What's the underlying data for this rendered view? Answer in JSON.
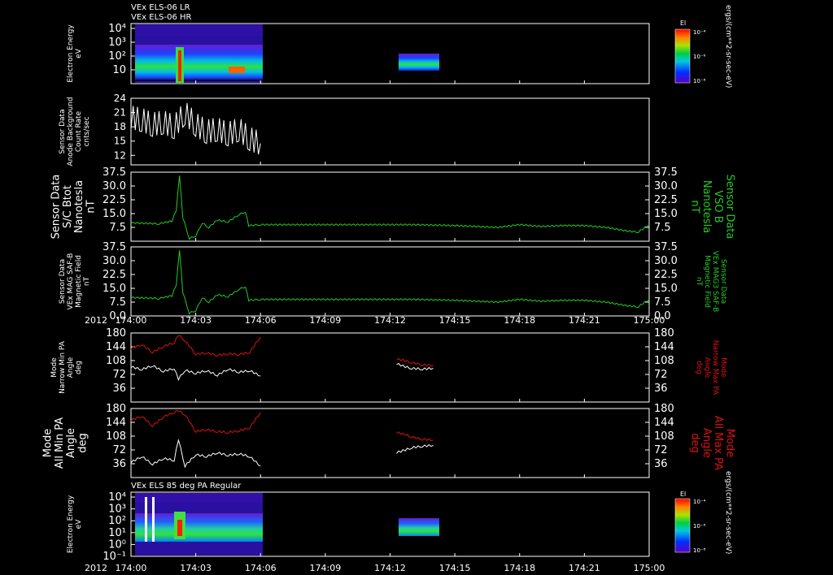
{
  "titles": {
    "top_line1": "VEx ELS-06 LR",
    "top_line2": "VEx ELS-06 HR",
    "bottom": "VEx ELS 85 deg PA Regular"
  },
  "colors": {
    "background": "#000000",
    "frame": "#ffffff",
    "white_trace": "#ffffff",
    "green_trace": "#22cc22",
    "red_trace": "#dd1111"
  },
  "colorbars": [
    {
      "label": "El",
      "ticks": [
        "10⁻⁴",
        "10⁻⁶",
        "10⁻⁸"
      ],
      "unit": "ergs/(cm**2-sr-sec-eV)"
    },
    {
      "label": "El",
      "ticks": [
        "10⁻⁴",
        "10⁻⁶",
        "10⁻⁸"
      ],
      "unit": "ergs/(cm**2-sr-sec-eV)"
    }
  ],
  "x_axis": {
    "year": "2012",
    "ticks": [
      "174:00",
      "174:03",
      "174:06",
      "174:09",
      "174:12",
      "174:15",
      "174:18",
      "174:21",
      "175:00"
    ]
  },
  "chart_data": [
    {
      "type": "heatmap",
      "ylabel": [
        "Electron Energy",
        "eV"
      ],
      "y_scale": "log",
      "y_ticks": [
        "10⁴",
        "10³",
        "10²",
        "10",
        ""
      ],
      "coverage_minutes": [
        [
          0,
          6
        ],
        [
          12.3,
          14
        ]
      ]
    },
    {
      "type": "line",
      "ylabel": [
        "Sensor Data",
        "Anode Background",
        "Count Rate",
        "cnts/sec"
      ],
      "y_ticks": [
        "24",
        "21",
        "18",
        "15",
        "12"
      ],
      "ylim": [
        10,
        24
      ],
      "series": [
        {
          "color": "#ffffff",
          "x": [
            0,
            0.5,
            1,
            1.5,
            2,
            2.5,
            3,
            3.5,
            4,
            4.5,
            5,
            5.5,
            6
          ],
          "values": [
            20,
            19.5,
            18.5,
            19,
            18,
            21,
            18.5,
            17,
            17.5,
            16.5,
            17.5,
            15.5,
            14.5
          ]
        }
      ]
    },
    {
      "type": "line",
      "ylabel": [
        "Sensor Data",
        "S/C Btot",
        "Nanotesla",
        "nT"
      ],
      "ylabel_right": [
        "Sensor Data",
        "VSO B",
        "Nanotesla",
        "nT"
      ],
      "y_ticks": [
        "37.5",
        "30.0",
        "22.5",
        "15.0",
        "7.5"
      ],
      "ylim": [
        0,
        37.5
      ],
      "series": [
        {
          "color": "#22cc22",
          "x": [
            0,
            1.3,
            1.9,
            2.1,
            2.25,
            2.4,
            2.7,
            3,
            3.3,
            3.6,
            4,
            4.5,
            5,
            5.3,
            5.45,
            6,
            9,
            13,
            15,
            16,
            17,
            18,
            19,
            20,
            21,
            22,
            23,
            23.5,
            24
          ],
          "values": [
            10,
            9.5,
            11,
            17,
            36,
            13,
            1.5,
            3,
            10,
            7.5,
            11.5,
            10.5,
            14.5,
            16,
            8.5,
            9,
            9,
            9,
            8.5,
            8,
            7.5,
            9,
            8,
            8.5,
            8.5,
            7.5,
            5.5,
            5,
            9
          ]
        }
      ]
    },
    {
      "type": "line",
      "ylabel": [
        "Sensor Data",
        "VEx MAG SAF-B",
        "Magnetic Field",
        "nT"
      ],
      "ylabel_right": [
        "Sensor Data",
        "VEx MAG3 SAF-B",
        "Magnetic Field",
        "nT"
      ],
      "y_ticks": [
        "37.5",
        "30.0",
        "22.5",
        "15.0",
        "7.5",
        "0.0"
      ],
      "ylim": [
        0,
        37.5
      ],
      "series": [
        {
          "color": "#22cc22",
          "x": [
            0,
            1.3,
            1.9,
            2.1,
            2.25,
            2.4,
            2.7,
            3,
            3.3,
            3.6,
            4,
            4.5,
            5,
            5.3,
            5.45,
            6,
            9,
            13,
            15,
            16,
            17,
            18,
            19,
            20,
            21,
            22,
            23,
            23.5,
            24
          ],
          "values": [
            10,
            9.5,
            11,
            17,
            36,
            13,
            1.5,
            3,
            10,
            7.5,
            11.5,
            10.5,
            14.5,
            16,
            8.5,
            9,
            9,
            9,
            8.5,
            8,
            7.5,
            9,
            8,
            8.5,
            8.5,
            7.5,
            5.5,
            5,
            9
          ]
        }
      ]
    },
    {
      "type": "line",
      "ylabel": [
        "Mode",
        "Narrow Min PA",
        "Angle",
        "deg"
      ],
      "ylabel_right": [
        "Mode",
        "Narrow Max PA",
        "Angle",
        "deg"
      ],
      "y_ticks": [
        "180",
        "144",
        "108",
        "72",
        "36"
      ],
      "ylim": [
        0,
        180
      ],
      "series": [
        {
          "color": "#dd1111",
          "segments": [
            {
              "x": [
                0,
                0.5,
                1,
                1.5,
                2,
                2.2,
                2.5,
                3,
                3.5,
                4,
                4.5,
                5,
                5.5,
                6
              ],
              "values": [
                140,
                150,
                130,
                145,
                155,
                175,
                160,
                125,
                128,
                122,
                126,
                124,
                130,
                170
              ]
            },
            {
              "x": [
                12.3,
                12.7,
                13,
                13.5,
                14
              ],
              "values": [
                112,
                108,
                103,
                97,
                96
              ]
            }
          ]
        },
        {
          "color": "#ffffff",
          "segments": [
            {
              "x": [
                0,
                0.5,
                1,
                1.5,
                2,
                2.2,
                2.5,
                3,
                3.5,
                4,
                4.5,
                5,
                5.5,
                6
              ],
              "values": [
                92,
                85,
                95,
                80,
                88,
                60,
                83,
                75,
                82,
                70,
                86,
                78,
                82,
                68
              ]
            },
            {
              "x": [
                12.3,
                12.7,
                13,
                13.5,
                14
              ],
              "values": [
                100,
                92,
                88,
                86,
                88
              ]
            }
          ]
        }
      ]
    },
    {
      "type": "line",
      "ylabel": [
        "Mode",
        "All Min PA",
        "Angle",
        "deg"
      ],
      "ylabel_right": [
        "Mode",
        "All Max PA",
        "Angle",
        "deg"
      ],
      "y_ticks": [
        "180",
        "144",
        "108",
        "72",
        "36"
      ],
      "ylim": [
        0,
        180
      ],
      "series": [
        {
          "color": "#dd1111",
          "segments": [
            {
              "x": [
                0,
                0.5,
                1,
                1.5,
                2,
                2.2,
                2.5,
                3,
                3.5,
                4,
                4.5,
                5,
                5.5,
                6
              ],
              "values": [
                150,
                160,
                135,
                158,
                170,
                175,
                165,
                120,
                125,
                120,
                118,
                122,
                130,
                170
              ]
            },
            {
              "x": [
                12.3,
                12.7,
                13,
                13.5,
                14
              ],
              "values": [
                118,
                112,
                106,
                100,
                98
              ]
            }
          ]
        },
        {
          "color": "#ffffff",
          "segments": [
            {
              "x": [
                0,
                0.5,
                1,
                1.5,
                2,
                2.2,
                2.5,
                3,
                3.5,
                4,
                4.5,
                5,
                5.5,
                6
              ],
              "values": [
                40,
                55,
                35,
                50,
                45,
                100,
                30,
                60,
                55,
                65,
                58,
                62,
                55,
                30
              ]
            },
            {
              "x": [
                12.3,
                12.7,
                13,
                13.5,
                14
              ],
              "values": [
                65,
                72,
                78,
                82,
                84
              ]
            }
          ]
        }
      ]
    },
    {
      "type": "heatmap",
      "ylabel": [
        "Electron Energy",
        "eV"
      ],
      "y_scale": "log",
      "y_ticks": [
        "10⁴",
        "10³",
        "10²",
        "10¹",
        "10⁰",
        "10⁻¹"
      ],
      "coverage_minutes": [
        [
          0,
          6
        ],
        [
          12.3,
          14
        ]
      ]
    }
  ]
}
